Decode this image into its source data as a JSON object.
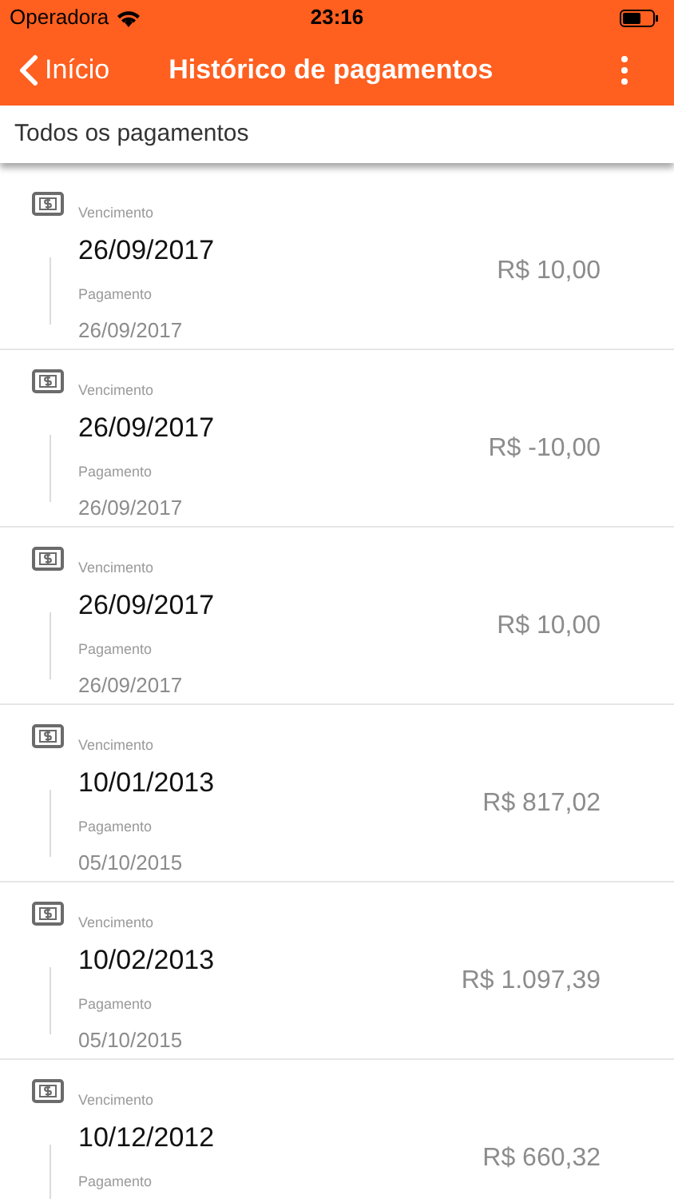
{
  "status_bar": {
    "carrier": "Operadora",
    "time": "23:16"
  },
  "nav": {
    "back": "Início",
    "title": "Histórico de pagamentos"
  },
  "filter": {
    "label": "Todos os pagamentos"
  },
  "payments": [
    {
      "due_label": "Vencimento",
      "due_date": "26/09/2017",
      "paid_label": "Pagamento",
      "paid_date": "26/09/2017",
      "amount": "R$ 10,00"
    },
    {
      "due_label": "Vencimento",
      "due_date": "26/09/2017",
      "paid_label": "Pagamento",
      "paid_date": "26/09/2017",
      "amount": "R$ -10,00"
    },
    {
      "due_label": "Vencimento",
      "due_date": "26/09/2017",
      "paid_label": "Pagamento",
      "paid_date": "26/09/2017",
      "amount": "R$ 10,00"
    },
    {
      "due_label": "Vencimento",
      "due_date": "10/01/2013",
      "paid_label": "Pagamento",
      "paid_date": "05/10/2015",
      "amount": "R$ 817,02"
    },
    {
      "due_label": "Vencimento",
      "due_date": "10/02/2013",
      "paid_label": "Pagamento",
      "paid_date": "05/10/2015",
      "amount": "R$ 1.097,39"
    },
    {
      "due_label": "Vencimento",
      "due_date": "10/12/2012",
      "paid_label": "Pagamento",
      "amount": "R$ 660,32"
    }
  ]
}
